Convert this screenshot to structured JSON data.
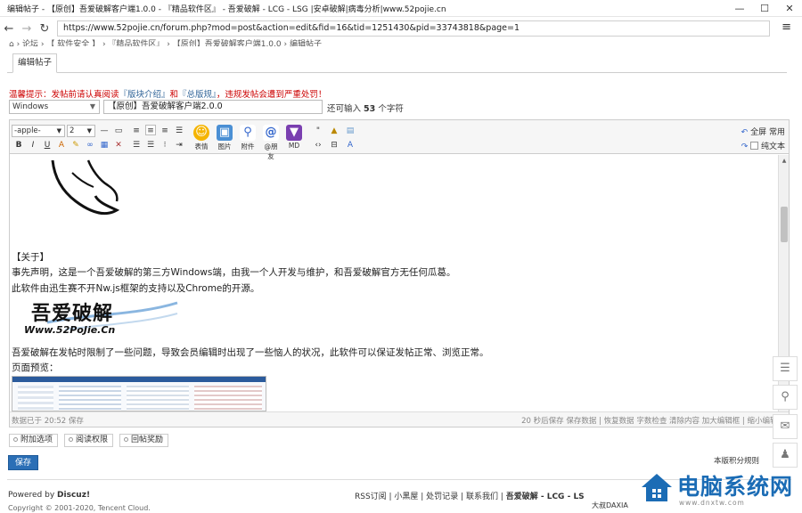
{
  "window": {
    "title": "编辑帖子 - 【原创】吾爱破解客户端1.0.0 - 『精品软件区』 - 吾爱破解 - LCG - LSG |安卓破解|病毒分析|www.52pojie.cn",
    "minimize": "—",
    "maximize": "☐",
    "close": "✕"
  },
  "address_bar": {
    "url": "https://www.52pojie.cn/forum.php?mod=post&action=edit&fid=16&tid=1251430&pid=33743818&page=1",
    "menu_icon": "≡"
  },
  "breadcrumb": "⌂  ›  论坛  ›  【 软件安全 】  ›  『精品软件区』  ›  【原创】吾爱破解客户端1.0.0  ›  编辑帖子",
  "tab": {
    "label": "编辑帖子"
  },
  "warning": {
    "prefix": "温馨提示：发帖前请认真阅读",
    "link1": "『版块介绍』",
    "mid": "和",
    "link2": "『总版规』",
    "suffix": "，违规发帖会遭到严重处罚！"
  },
  "post_type": {
    "selected": "Windows"
  },
  "subject": {
    "value": "【原创】吾爱破解客户端2.0.0"
  },
  "remaining": {
    "prefix": "还可输入",
    "count": "53",
    "suffix": "个字符"
  },
  "editor": {
    "font": "-apple-",
    "size": "2",
    "big_buttons": [
      "表情",
      "图片",
      "附件",
      "@朋友",
      "MD"
    ],
    "fullscreen": "全屏",
    "common": "常用",
    "plaintext": "纯文本",
    "content": {
      "heading": "【关于】",
      "line1": "事先声明，这是一个吾爱破解的第三方Windows端，由我一个人开发与维护，和吾爱破解官方无任何瓜葛。",
      "line2": "此软件由迅生赛不开Nw.js框架的支持以及Chrome的开源。",
      "logo_text": "吾爱破解",
      "logo_url": "Www.52PoJie.Cn",
      "line3": "吾爱破解在发帖时限制了一些问题，导致会员编辑时出现了一些恼人的状况，此软件可以保证发帖正常、浏览正常。",
      "line4": "页面预览："
    },
    "status_left": "数据已于 20:52 保存",
    "status_right": "20 秒后保存 保存数据 | 恢复数据    字数检查    清除内容    加大编辑框 | 缩小编辑框"
  },
  "options": [
    "附加选项",
    "阅读权限",
    "回帖奖励"
  ],
  "save_button": "保存",
  "rules_hint": "本版积分规则",
  "footer": {
    "powered_prefix": "Powered by",
    "powered_brand": "Discuz!",
    "copyright": "Copyright © 2001-2020, Tencent Cloud.",
    "links": "RSS订阅 | 小黑屋 | 处罚记录 | 联系我们 |",
    "brand": "吾爱破解 - LCG - LS",
    "corner": "大叔DAXIA"
  },
  "watermark": {
    "text": "电脑系统网",
    "url": "www.dnxtw.com"
  },
  "colors": {
    "accent": "#2b6fb6",
    "warning": "#cc0000",
    "watermark": "#1b6cb5"
  }
}
